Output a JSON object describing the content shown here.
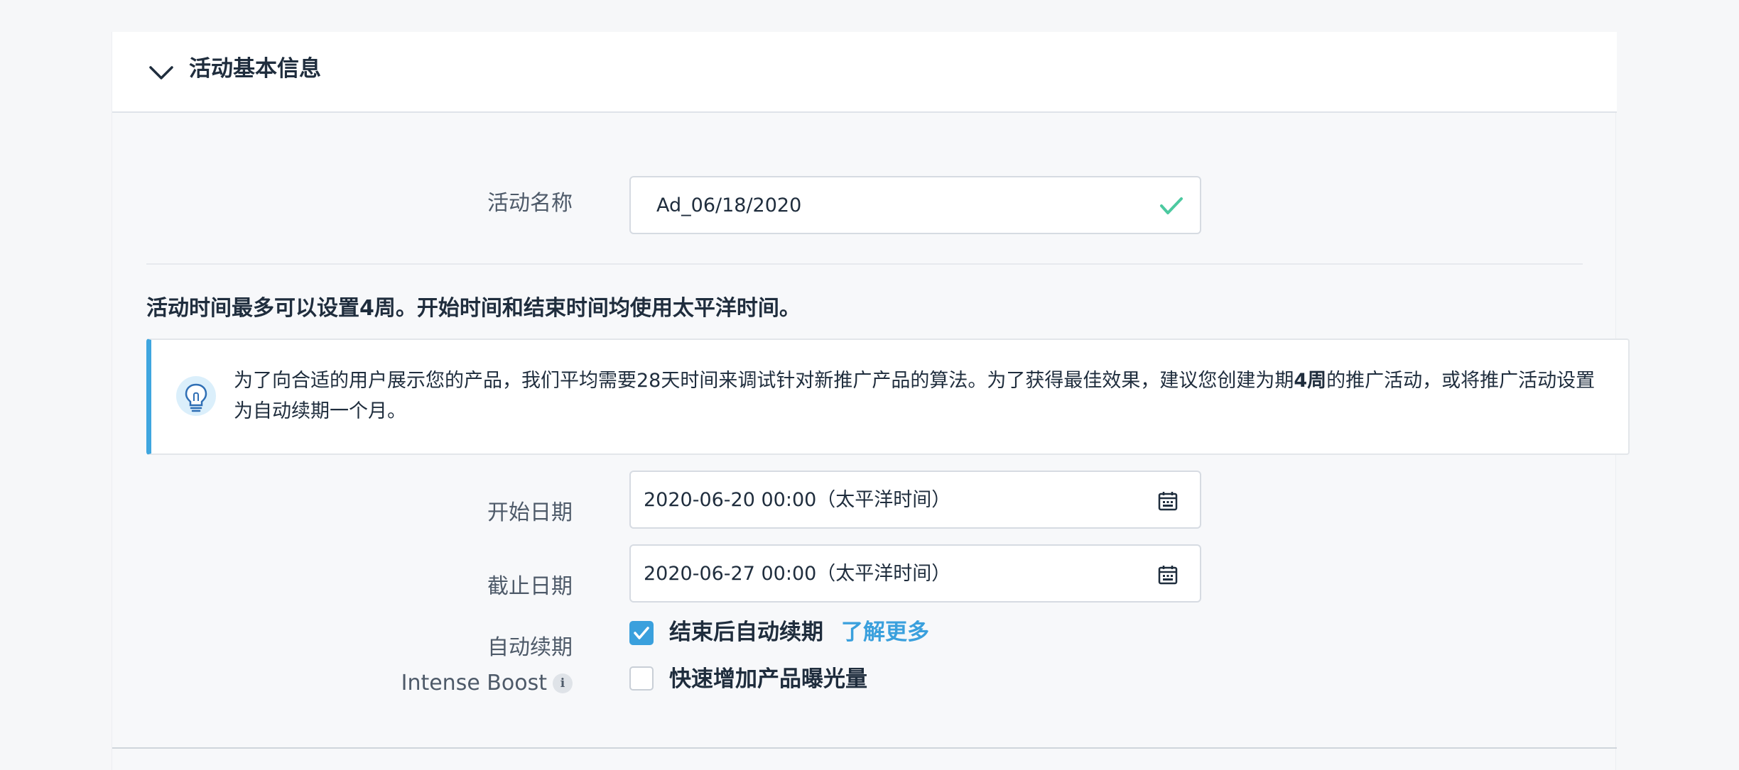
{
  "section": {
    "title": "活动基本信息"
  },
  "campaign_name": {
    "label": "活动名称",
    "value": "Ad_06/18/2020"
  },
  "schedule": {
    "notice": "活动时间最多可以设置4周。开始时间和结束时间均使用太平洋时间。",
    "tip_part1": "为了向合适的用户展示您的产品，我们平均需要28天时间来调试针对新推广产品的算法。为了获得最佳效果，建议您创建为期",
    "tip_bold": "4周",
    "tip_part2": "的推广活动，或将推广活动设置为自动续期一个月。"
  },
  "start_date": {
    "label": "开始日期",
    "value": "2020-06-20 00:00（太平洋时间）"
  },
  "end_date": {
    "label": "截止日期",
    "value": "2020-06-27 00:00（太平洋时间）"
  },
  "auto_renew": {
    "label": "自动续期",
    "checkbox_label": "结束后自动续期",
    "checked": true,
    "link": "了解更多"
  },
  "intense_boost": {
    "label": "Intense Boost",
    "info_glyph": "i",
    "checkbox_label": "快速增加产品曝光量",
    "checked": false
  },
  "colors": {
    "accent": "#3aa0dd",
    "success": "#4cc9a0",
    "tip_border": "#3fa6df"
  }
}
